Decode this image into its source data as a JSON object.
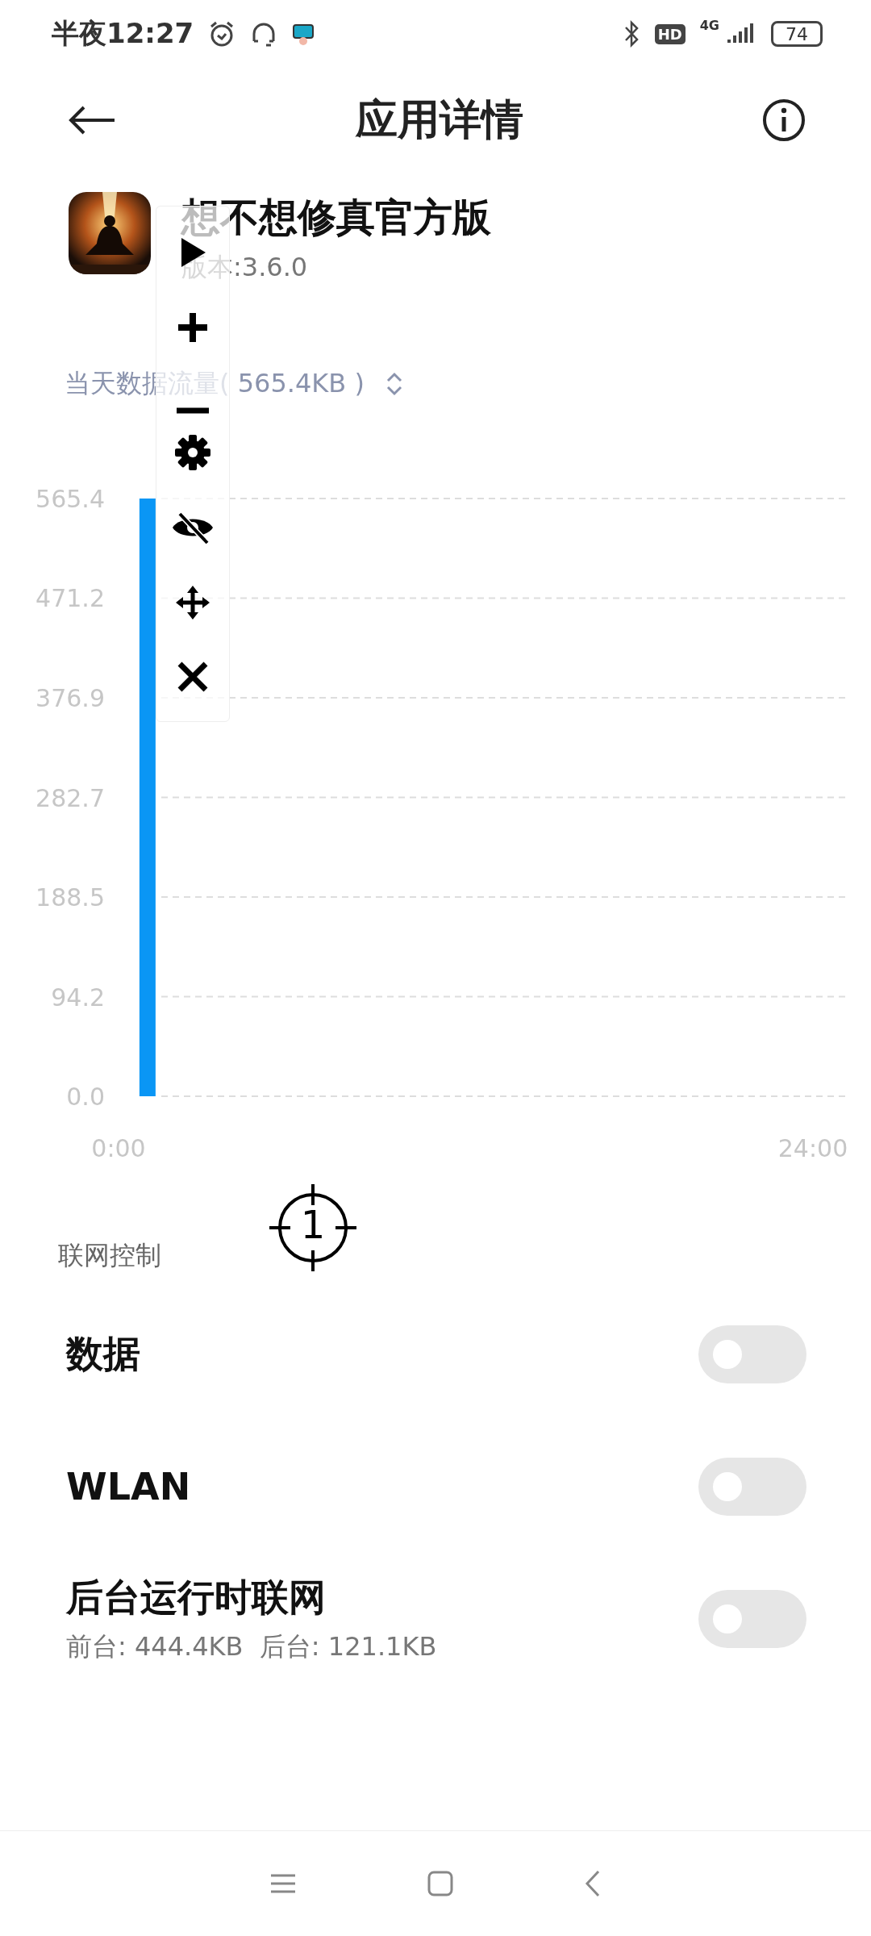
{
  "status_bar": {
    "time": "半夜12:27",
    "hd": "HD",
    "network": "4G",
    "battery": "74"
  },
  "header": {
    "title": "应用详情"
  },
  "app": {
    "name": "想不想修真官方版",
    "version": "版本:3.6.0"
  },
  "usage": {
    "label": "当天数据流量( 565.4KB )"
  },
  "chart": {
    "chart_data": {
      "type": "bar",
      "grid": true,
      "x": [
        1
      ],
      "series": [
        {
          "color": "#0a96f5",
          "values": [
            565.4
          ]
        }
      ],
      "xlim": [
        0,
        25.2
      ],
      "ylim": [
        0,
        565.4
      ],
      "xticks": [
        {
          "value": 0,
          "label": "0:00"
        },
        {
          "value": 24,
          "label": "24:00"
        }
      ],
      "yticks": [
        {
          "value": 0,
          "label": "0.0"
        },
        {
          "value": 94.2,
          "label": "94.2"
        },
        {
          "value": 188.5,
          "label": "188.5"
        },
        {
          "value": 282.7,
          "label": "282.7"
        },
        {
          "value": 376.9,
          "label": "376.9"
        },
        {
          "value": 471.2,
          "label": "471.2"
        },
        {
          "value": 565.4,
          "label": "565.4"
        }
      ]
    }
  },
  "marker": {
    "label": "1"
  },
  "section": {
    "title": "联网控制"
  },
  "toggles": [
    {
      "label": "数据",
      "on": false
    },
    {
      "label": "WLAN",
      "on": false
    },
    {
      "label": "后台运行时联网",
      "detail": "前台: 444.4KB  后台: 121.1KB",
      "on": false
    }
  ]
}
